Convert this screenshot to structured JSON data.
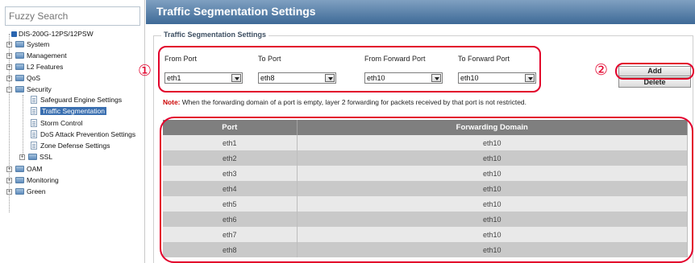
{
  "sidebar": {
    "search_placeholder": "Fuzzy Search",
    "device": "DIS-200G-12PS/12PSW",
    "items": {
      "system": "System",
      "management": "Management",
      "l2": "L2 Features",
      "qos": "QoS",
      "security": "Security",
      "safeguard": "Safeguard Engine Settings",
      "traffic": "Traffic Segmentation",
      "storm": "Storm Control",
      "dos": "DoS Attack Prevention Settings",
      "zone": "Zone Defense Settings",
      "ssl": "SSL",
      "oam": "OAM",
      "monitoring": "Monitoring",
      "green": "Green"
    }
  },
  "page": {
    "title": "Traffic Segmentation Settings",
    "section_title": "Traffic Segmentation Settings"
  },
  "form": {
    "from_port_label": "From Port",
    "to_port_label": "To Port",
    "from_forward_label": "From Forward Port",
    "to_forward_label": "To Forward Port",
    "from_port_value": "eth1",
    "to_port_value": "eth8",
    "from_forward_value": "eth10",
    "to_forward_value": "eth10",
    "add_label": "Add",
    "delete_label": "Delete"
  },
  "note": {
    "prefix": "Note:",
    "text": " When the forwarding domain of a port is empty, layer 2 forwarding for packets received by that port is not restricted."
  },
  "table": {
    "headers": [
      "Port",
      "Forwarding Domain"
    ],
    "rows": [
      [
        "eth1",
        "eth10"
      ],
      [
        "eth2",
        "eth10"
      ],
      [
        "eth3",
        "eth10"
      ],
      [
        "eth4",
        "eth10"
      ],
      [
        "eth5",
        "eth10"
      ],
      [
        "eth6",
        "eth10"
      ],
      [
        "eth7",
        "eth10"
      ],
      [
        "eth8",
        "eth10"
      ]
    ]
  },
  "annotations": {
    "marker_1": "①",
    "marker_2": "②"
  }
}
